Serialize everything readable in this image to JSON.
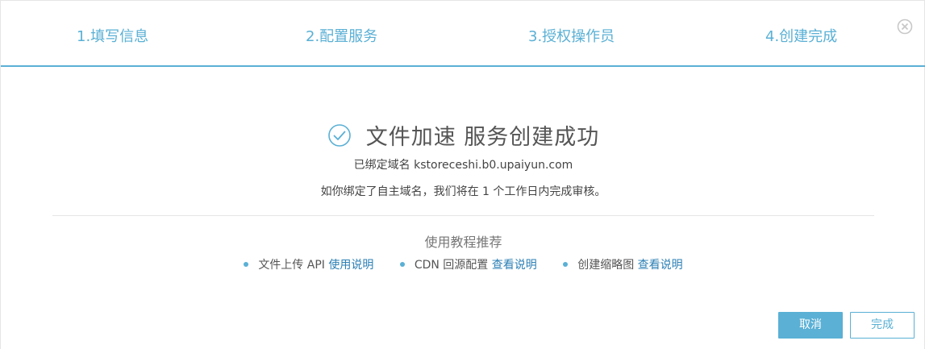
{
  "steps": [
    {
      "label": "1.填写信息"
    },
    {
      "label": "2.配置服务"
    },
    {
      "label": "3.授权操作员"
    },
    {
      "label": "4.创建完成"
    }
  ],
  "success": {
    "title": "文件加速 服务创建成功",
    "domain_line": "已绑定域名 kstoreceshi.b0.upaiyun.com",
    "note_line": "如你绑定了自主域名，我们将在 1 个工作日内完成审核。"
  },
  "tutorials": {
    "title": "使用教程推荐",
    "items": [
      {
        "text": "文件上传 API",
        "link": "使用说明"
      },
      {
        "text": "CDN 回源配置",
        "link": "查看说明"
      },
      {
        "text": "创建缩略图",
        "link": "查看说明"
      }
    ]
  },
  "buttons": {
    "cancel": "取消",
    "done": "完成"
  },
  "colors": {
    "accent": "#5ab0d5",
    "link": "#2b7fb4"
  }
}
